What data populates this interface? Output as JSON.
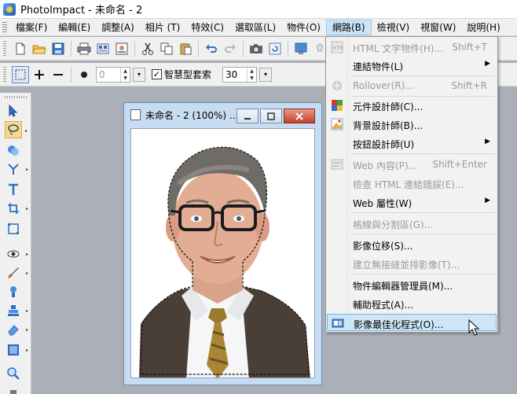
{
  "window": {
    "title": "PhotoImpact - 未命名 - 2"
  },
  "menubar": {
    "items": [
      "檔案(F)",
      "編輯(E)",
      "調整(A)",
      "相片 (T)",
      "特效(C)",
      "選取區(L)",
      "物件(O)",
      "網路(B)",
      "檢視(V)",
      "視窗(W)",
      "說明(H)"
    ],
    "active": "網路(B)"
  },
  "attributes_toolbar": {
    "value1": "0",
    "smart_lasso_label": "智慧型套索",
    "smart_lasso_checked": true,
    "value2": "30"
  },
  "document": {
    "title": "未命名 - 2 (100%) ..."
  },
  "dropdown": {
    "items": [
      {
        "label": "HTML 文字物件(H)...",
        "shortcut": "Shift+T",
        "disabled": true,
        "icon": "html-text-icon"
      },
      {
        "label": "連結物件(L)",
        "submenu": true,
        "disabled": false
      },
      {
        "label": "Rollover(R)...",
        "shortcut": "Shift+R",
        "disabled": true,
        "icon": "rollover-icon"
      },
      {
        "label": "元件設計師(C)...",
        "disabled": false,
        "icon": "component-designer-icon"
      },
      {
        "label": "背景設計師(B)...",
        "disabled": false,
        "icon": "background-designer-icon"
      },
      {
        "label": "按鈕設計師(U)",
        "submenu": true,
        "disabled": false
      },
      {
        "label": "Web 內容(P)...",
        "shortcut": "Shift+Enter",
        "disabled": true,
        "icon": "web-content-icon"
      },
      {
        "label": "檢查 HTML 連結錯誤(E)...",
        "disabled": true
      },
      {
        "label": "Web 屬性(W)",
        "submenu": true,
        "disabled": false
      },
      {
        "label": "格線與分割區(G)...",
        "disabled": true
      },
      {
        "label": "影像位移(S)...",
        "disabled": false
      },
      {
        "label": "建立無接縫並排影像(T)...",
        "disabled": true
      },
      {
        "label": "物件編輯器管理員(M)...",
        "disabled": false
      },
      {
        "label": "輔助程式(A)...",
        "disabled": false
      },
      {
        "label": "影像最佳化程式(O)...",
        "disabled": false,
        "highlighted": true,
        "icon": "image-optimizer-icon"
      }
    ]
  }
}
